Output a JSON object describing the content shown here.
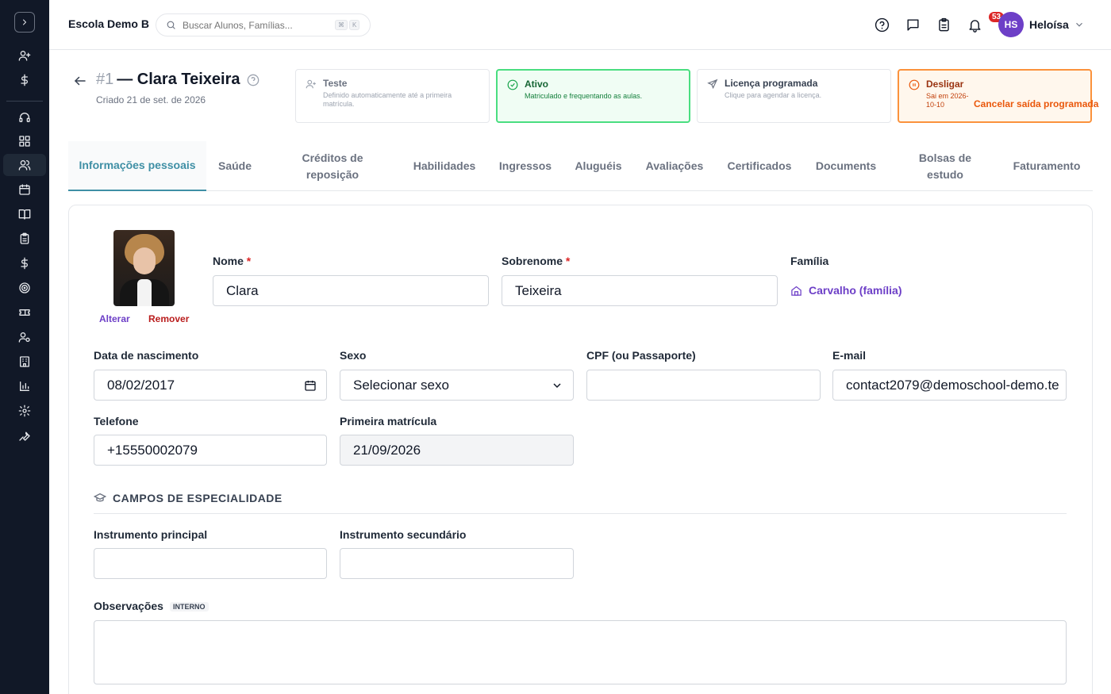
{
  "header": {
    "school_name": "Escola Demo B",
    "search_placeholder": "Buscar Alunos, Famílias...",
    "shortcut_keys": [
      "⌘",
      "K"
    ],
    "notification_count": "53",
    "user": {
      "initials": "HS",
      "name": "Heloísa"
    }
  },
  "sidebar": {
    "items": [
      {
        "icon": "user-plus-icon"
      },
      {
        "icon": "dollar-icon"
      },
      {
        "icon": "headset-icon"
      },
      {
        "icon": "dashboard-icon"
      },
      {
        "icon": "users-icon",
        "active": true
      },
      {
        "icon": "calendar-icon"
      },
      {
        "icon": "book-icon"
      },
      {
        "icon": "clipboard-icon"
      },
      {
        "icon": "dollar-icon"
      },
      {
        "icon": "target-icon"
      },
      {
        "icon": "ticket-icon"
      },
      {
        "icon": "user-settings-icon"
      },
      {
        "icon": "building-icon"
      },
      {
        "icon": "bar-chart-icon"
      },
      {
        "icon": "gear-icon"
      },
      {
        "icon": "wrench-icon"
      }
    ]
  },
  "student": {
    "number": "#1",
    "name": "— Clara Teixeira",
    "created": "Criado 21 de set. de 2026"
  },
  "status_cards": [
    {
      "title": "Teste",
      "subtitle": "Definido automaticamente até a primeira matrícula."
    },
    {
      "title": "Ativo",
      "subtitle": "Matriculado e frequentando as aulas."
    },
    {
      "title": "Licença programada",
      "subtitle": "Clique para agendar a licença."
    },
    {
      "title": "Desligar",
      "subtitle": "Sai em 2026-10-10",
      "action": "Cancelar saída programada"
    }
  ],
  "tabs": [
    "Informações pessoais",
    "Saúde",
    "Créditos de reposição",
    "Habilidades",
    "Ingressos",
    "Aluguéis",
    "Avaliações",
    "Certificados",
    "Documents",
    "Bolsas de estudo",
    "Faturamento"
  ],
  "photo": {
    "change_label": "Alterar",
    "remove_label": "Remover"
  },
  "form": {
    "first_name": {
      "label": "Nome",
      "required": "*",
      "value": "Clara"
    },
    "last_name": {
      "label": "Sobrenome",
      "required": "*",
      "value": "Teixeira"
    },
    "family": {
      "label": "Família",
      "value": "Carvalho (família)"
    },
    "birth_date": {
      "label": "Data de nascimento",
      "value": "08/02/2017"
    },
    "sex": {
      "label": "Sexo",
      "value": "Selecionar sexo"
    },
    "cpf": {
      "label": "CPF (ou Passaporte)",
      "value": ""
    },
    "email": {
      "label": "E-mail",
      "value": "contact2079@demoschool-demo.te"
    },
    "phone": {
      "label": "Telefone",
      "value": "+15550002079"
    },
    "first_enrollment": {
      "label": "Primeira matrícula",
      "value": "21/09/2026"
    }
  },
  "specialty": {
    "heading": "CAMPOS DE ESPECIALIDADE",
    "primary_instrument": {
      "label": "Instrumento principal",
      "value": ""
    },
    "secondary_instrument": {
      "label": "Instrumento secundário",
      "value": ""
    }
  },
  "notes": {
    "label": "Observações",
    "tag": "INTERNO",
    "value": ""
  },
  "colors": {
    "accent_teal": "#3f8fa5",
    "brand_purple": "#6d3fc7",
    "active_green": "#4ade80",
    "exit_orange": "#fb923c",
    "sidebar_bg": "#111827"
  }
}
